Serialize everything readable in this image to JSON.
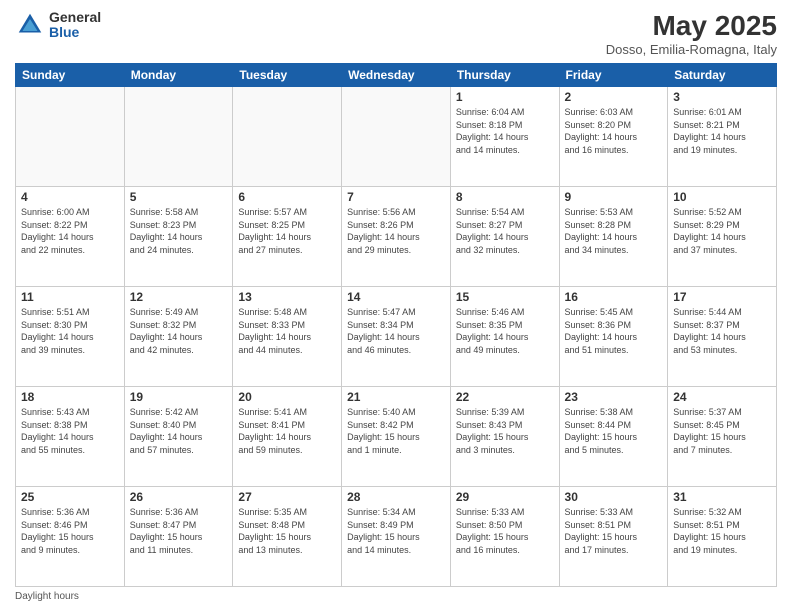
{
  "logo": {
    "general": "General",
    "blue": "Blue"
  },
  "title": "May 2025",
  "location": "Dosso, Emilia-Romagna, Italy",
  "days_of_week": [
    "Sunday",
    "Monday",
    "Tuesday",
    "Wednesday",
    "Thursday",
    "Friday",
    "Saturday"
  ],
  "weeks": [
    [
      {
        "day": "",
        "info": ""
      },
      {
        "day": "",
        "info": ""
      },
      {
        "day": "",
        "info": ""
      },
      {
        "day": "",
        "info": ""
      },
      {
        "day": "1",
        "info": "Sunrise: 6:04 AM\nSunset: 8:18 PM\nDaylight: 14 hours\nand 14 minutes."
      },
      {
        "day": "2",
        "info": "Sunrise: 6:03 AM\nSunset: 8:20 PM\nDaylight: 14 hours\nand 16 minutes."
      },
      {
        "day": "3",
        "info": "Sunrise: 6:01 AM\nSunset: 8:21 PM\nDaylight: 14 hours\nand 19 minutes."
      }
    ],
    [
      {
        "day": "4",
        "info": "Sunrise: 6:00 AM\nSunset: 8:22 PM\nDaylight: 14 hours\nand 22 minutes."
      },
      {
        "day": "5",
        "info": "Sunrise: 5:58 AM\nSunset: 8:23 PM\nDaylight: 14 hours\nand 24 minutes."
      },
      {
        "day": "6",
        "info": "Sunrise: 5:57 AM\nSunset: 8:25 PM\nDaylight: 14 hours\nand 27 minutes."
      },
      {
        "day": "7",
        "info": "Sunrise: 5:56 AM\nSunset: 8:26 PM\nDaylight: 14 hours\nand 29 minutes."
      },
      {
        "day": "8",
        "info": "Sunrise: 5:54 AM\nSunset: 8:27 PM\nDaylight: 14 hours\nand 32 minutes."
      },
      {
        "day": "9",
        "info": "Sunrise: 5:53 AM\nSunset: 8:28 PM\nDaylight: 14 hours\nand 34 minutes."
      },
      {
        "day": "10",
        "info": "Sunrise: 5:52 AM\nSunset: 8:29 PM\nDaylight: 14 hours\nand 37 minutes."
      }
    ],
    [
      {
        "day": "11",
        "info": "Sunrise: 5:51 AM\nSunset: 8:30 PM\nDaylight: 14 hours\nand 39 minutes."
      },
      {
        "day": "12",
        "info": "Sunrise: 5:49 AM\nSunset: 8:32 PM\nDaylight: 14 hours\nand 42 minutes."
      },
      {
        "day": "13",
        "info": "Sunrise: 5:48 AM\nSunset: 8:33 PM\nDaylight: 14 hours\nand 44 minutes."
      },
      {
        "day": "14",
        "info": "Sunrise: 5:47 AM\nSunset: 8:34 PM\nDaylight: 14 hours\nand 46 minutes."
      },
      {
        "day": "15",
        "info": "Sunrise: 5:46 AM\nSunset: 8:35 PM\nDaylight: 14 hours\nand 49 minutes."
      },
      {
        "day": "16",
        "info": "Sunrise: 5:45 AM\nSunset: 8:36 PM\nDaylight: 14 hours\nand 51 minutes."
      },
      {
        "day": "17",
        "info": "Sunrise: 5:44 AM\nSunset: 8:37 PM\nDaylight: 14 hours\nand 53 minutes."
      }
    ],
    [
      {
        "day": "18",
        "info": "Sunrise: 5:43 AM\nSunset: 8:38 PM\nDaylight: 14 hours\nand 55 minutes."
      },
      {
        "day": "19",
        "info": "Sunrise: 5:42 AM\nSunset: 8:40 PM\nDaylight: 14 hours\nand 57 minutes."
      },
      {
        "day": "20",
        "info": "Sunrise: 5:41 AM\nSunset: 8:41 PM\nDaylight: 14 hours\nand 59 minutes."
      },
      {
        "day": "21",
        "info": "Sunrise: 5:40 AM\nSunset: 8:42 PM\nDaylight: 15 hours\nand 1 minute."
      },
      {
        "day": "22",
        "info": "Sunrise: 5:39 AM\nSunset: 8:43 PM\nDaylight: 15 hours\nand 3 minutes."
      },
      {
        "day": "23",
        "info": "Sunrise: 5:38 AM\nSunset: 8:44 PM\nDaylight: 15 hours\nand 5 minutes."
      },
      {
        "day": "24",
        "info": "Sunrise: 5:37 AM\nSunset: 8:45 PM\nDaylight: 15 hours\nand 7 minutes."
      }
    ],
    [
      {
        "day": "25",
        "info": "Sunrise: 5:36 AM\nSunset: 8:46 PM\nDaylight: 15 hours\nand 9 minutes."
      },
      {
        "day": "26",
        "info": "Sunrise: 5:36 AM\nSunset: 8:47 PM\nDaylight: 15 hours\nand 11 minutes."
      },
      {
        "day": "27",
        "info": "Sunrise: 5:35 AM\nSunset: 8:48 PM\nDaylight: 15 hours\nand 13 minutes."
      },
      {
        "day": "28",
        "info": "Sunrise: 5:34 AM\nSunset: 8:49 PM\nDaylight: 15 hours\nand 14 minutes."
      },
      {
        "day": "29",
        "info": "Sunrise: 5:33 AM\nSunset: 8:50 PM\nDaylight: 15 hours\nand 16 minutes."
      },
      {
        "day": "30",
        "info": "Sunrise: 5:33 AM\nSunset: 8:51 PM\nDaylight: 15 hours\nand 17 minutes."
      },
      {
        "day": "31",
        "info": "Sunrise: 5:32 AM\nSunset: 8:51 PM\nDaylight: 15 hours\nand 19 minutes."
      }
    ]
  ],
  "footer": "Daylight hours"
}
